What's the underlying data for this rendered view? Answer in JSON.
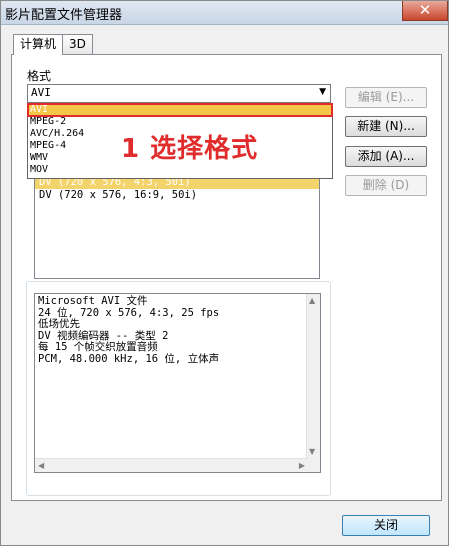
{
  "window": {
    "title": "影片配置文件管理器",
    "close_glyph": "✕"
  },
  "tabs": [
    {
      "label": "计算机"
    },
    {
      "label": "3D"
    }
  ],
  "format": {
    "label": "格式",
    "selected": "AVI",
    "options": [
      "AVI",
      "MPEG-2",
      "AVC/H.264",
      "MPEG-4",
      "WMV",
      "MOV"
    ]
  },
  "annotation": "1 选择格式",
  "profiles": [
    "DV (720 x 576, 4:3, 50i)",
    "DV (720 x 576, 16:9, 50i)"
  ],
  "buttons": {
    "edit": "编辑 (E)...",
    "new": "新建 (N)...",
    "add": "添加 (A)...",
    "delete": "删除 (D)",
    "close": "关闭"
  },
  "info_lines": [
    "Microsoft AVI 文件",
    "24 位, 720 x 576, 4:3, 25 fps",
    "低场优先",
    "DV 视频编码器 -- 类型 2",
    "每 15 个帧交织放置音频",
    "PCM, 48.000 kHz, 16 位, 立体声"
  ],
  "colors": {
    "selection": "#f3c64a",
    "annotation": "#e02c2c"
  }
}
